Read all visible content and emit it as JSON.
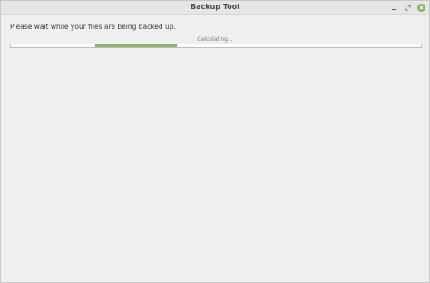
{
  "window": {
    "title": "Backup Tool"
  },
  "titlebar_controls": [
    "minimize-icon",
    "maximize-icon",
    "close-icon"
  ],
  "content": {
    "message": "Please wait while your files are being backed up.",
    "status": "Calculating..."
  },
  "progress": {
    "mode": "indeterminate",
    "segment_start": 0.205,
    "segment_end": 0.405
  },
  "colors": {
    "accent": "#8eb26f",
    "window_bg": "#efefef",
    "titlebar_bg": "#e6e6e6"
  }
}
